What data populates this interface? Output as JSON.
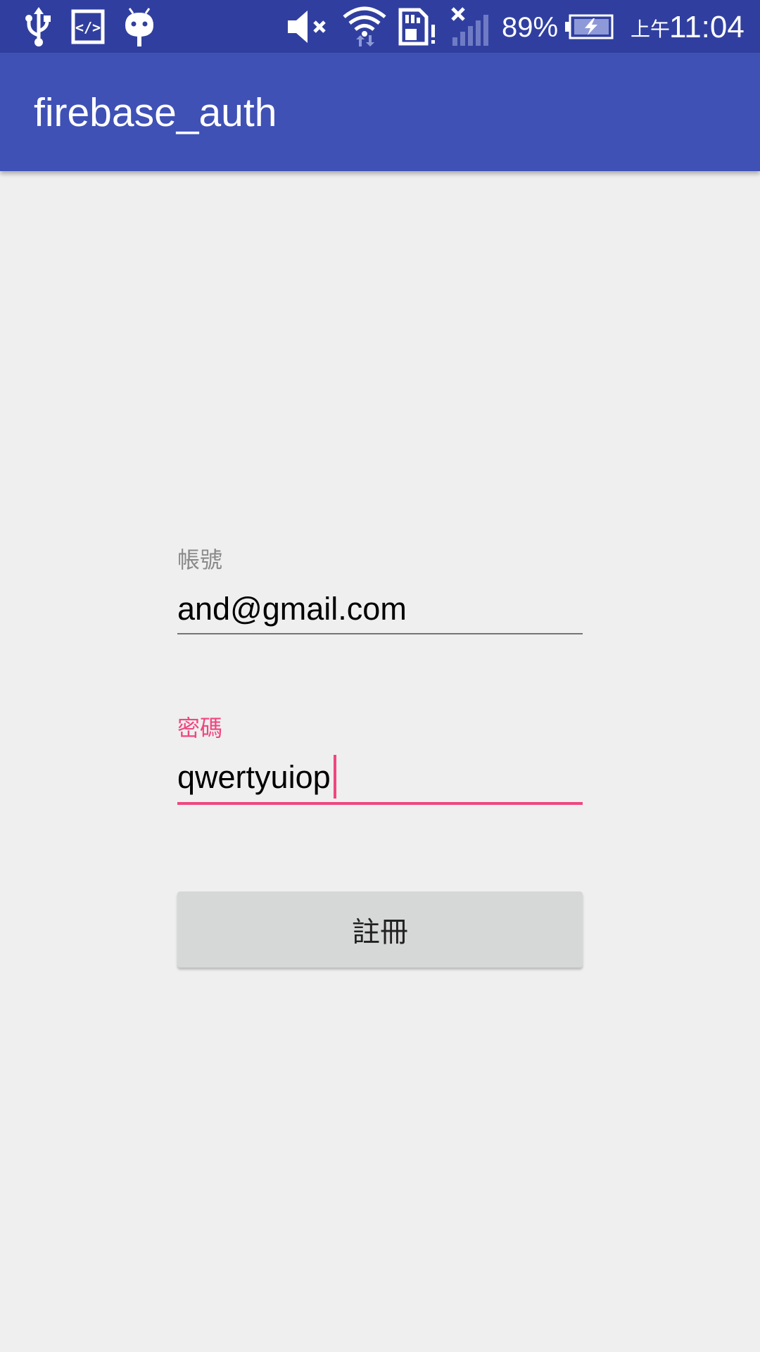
{
  "status_bar": {
    "icons": [
      "usb-icon",
      "developer-mode-icon",
      "android-debug-icon",
      "volume-mute-icon",
      "wifi-icon",
      "sd-card-alert-icon",
      "no-signal-icon",
      "battery-charging-icon"
    ],
    "battery_percent": "89%",
    "time_prefix": "上午",
    "time": "11:04"
  },
  "app_bar": {
    "title": "firebase_auth"
  },
  "form": {
    "account_label": "帳號",
    "account_value": "and@gmail.com",
    "password_label": "密碼",
    "password_value": "qwertyuiop",
    "register_label": "註冊"
  },
  "colors": {
    "status_bar": "#303f9f",
    "primary": "#3f51b5",
    "accent": "#f0467f",
    "background": "#efefef",
    "button": "#d6d7d7",
    "label_inactive": "#8a8a8a"
  }
}
